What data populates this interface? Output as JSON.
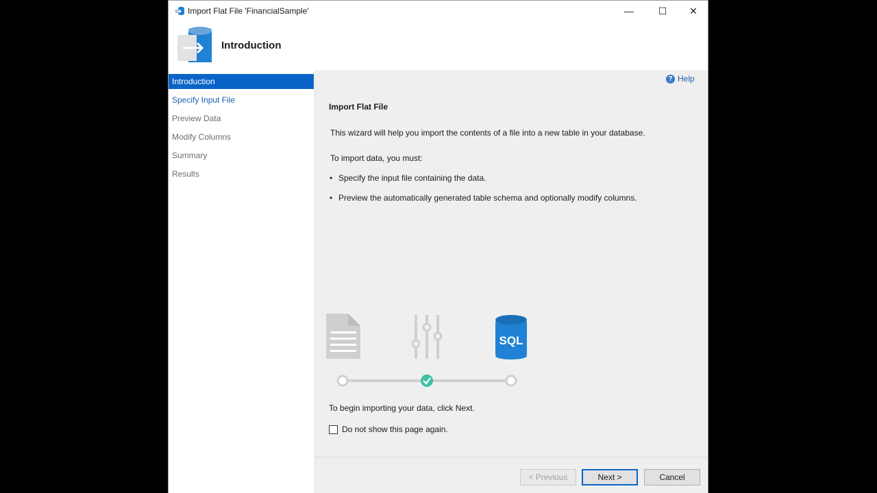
{
  "window": {
    "title": "Import Flat File 'FinancialSample'",
    "minimize_glyph": "—",
    "maximize_glyph": "☐",
    "close_glyph": "✕"
  },
  "header": {
    "title": "Introduction",
    "icon": "database-import-icon"
  },
  "sidebar": {
    "items": [
      {
        "label": "Introduction",
        "state": "active"
      },
      {
        "label": "Specify Input File",
        "state": "link"
      },
      {
        "label": "Preview Data",
        "state": "disabled"
      },
      {
        "label": "Modify Columns",
        "state": "disabled"
      },
      {
        "label": "Summary",
        "state": "disabled"
      },
      {
        "label": "Results",
        "state": "disabled"
      }
    ]
  },
  "content": {
    "help_label": "Help",
    "help_glyph": "?",
    "title": "Import Flat File",
    "intro": "This wizard will help you import the contents of a file into a new table in your database.",
    "requirements_heading": "To import data, you must:",
    "requirements": [
      "Specify the input file containing the data.",
      "Preview the automatically generated table schema and optionally modify columns."
    ],
    "graphic": {
      "sql_label": "SQL",
      "completed_step": 2
    },
    "begin_text": "To begin importing your data, click Next.",
    "checkbox_label": "Do not show this page again.",
    "checkbox_checked": false
  },
  "footer": {
    "previous_label": "< Previous",
    "next_label": "Next >",
    "cancel_label": "Cancel"
  },
  "colors": {
    "accent": "#0a64c8",
    "link": "#1b5fae",
    "sql_blue": "#1f82d4",
    "check_teal": "#3ec1a5",
    "graphic_gray": "#cfcfcf"
  }
}
